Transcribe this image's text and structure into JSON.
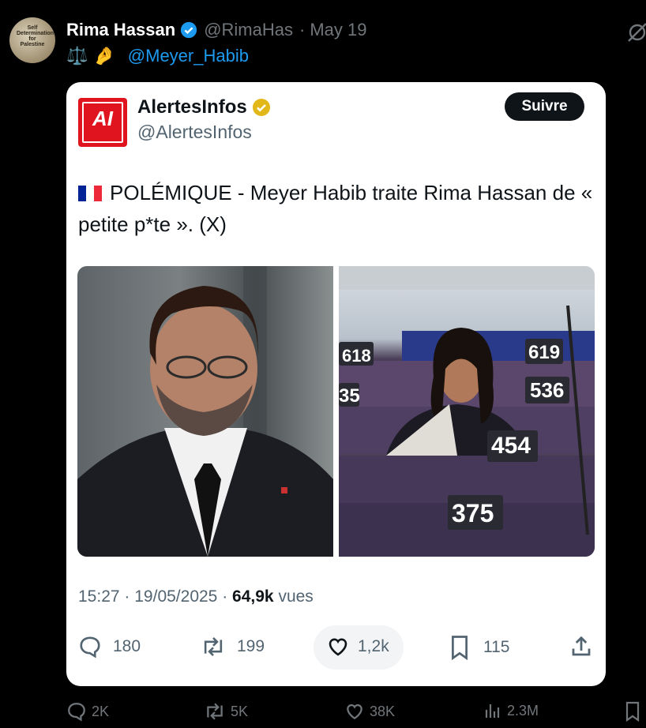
{
  "post": {
    "author_name": "Rima Hassan",
    "author_handle": "@RimaHas",
    "date_sep": "·",
    "date": "May 19",
    "avatar_text": "Self Determination for Palestine",
    "line2_emojis": "⚖️ 🤌",
    "mention": "@Meyer_Habib"
  },
  "quoted": {
    "logo_text": "AI",
    "name": "AlertesInfos",
    "handle": "@AlertesInfos",
    "follow_label": "Suivre",
    "text": "POLÉMIQUE - Meyer Habib traite Rima Hassan de « petite p*te ». (X)",
    "seat_numbers": [
      "618",
      "619",
      "35",
      "536",
      "454",
      "375"
    ],
    "time": "15:27",
    "sep": "·",
    "date": "19/05/2025",
    "views_count": "64,9k",
    "views_label": "vues",
    "replies": "180",
    "reposts": "199",
    "likes": "1,2k",
    "bookmarks": "115"
  },
  "bottom_bar": {
    "replies": "2K",
    "reposts": "5K",
    "likes": "38K",
    "views": "2.3M"
  },
  "colors": {
    "background": "#000000",
    "card": "#ffffff",
    "accent": "#1d9bf0",
    "verified_gold": "#e2b719",
    "logo_red": "#e0141e"
  }
}
